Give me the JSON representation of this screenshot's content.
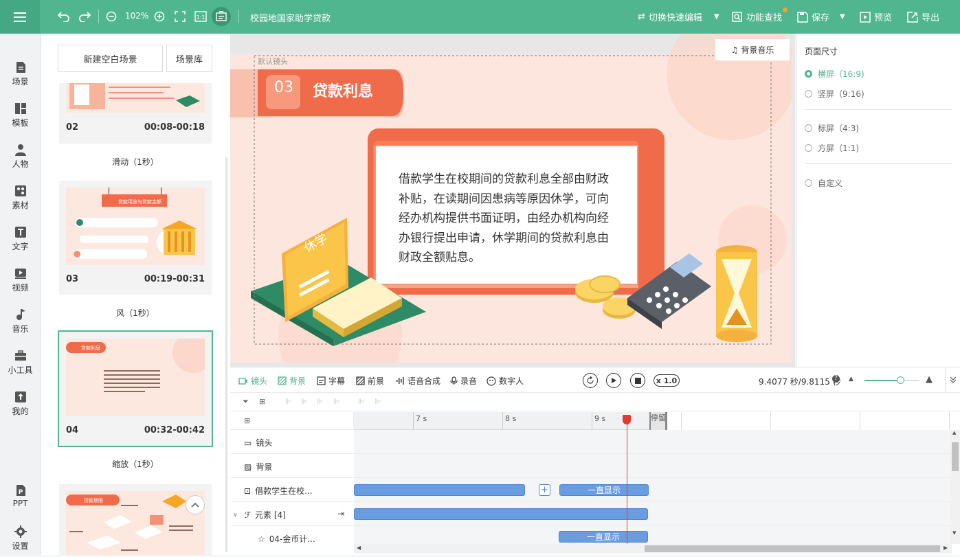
{
  "topbar": {
    "zoom": "102%",
    "title": "校园地国家助学贷款",
    "switch_edit": "切换快速编辑",
    "feature_search": "功能查找",
    "save": "保存",
    "preview": "预览",
    "export": "导出",
    "accent": "#4fb690"
  },
  "leftnav": {
    "items": [
      "场景",
      "模板",
      "人物",
      "素材",
      "文字",
      "视频",
      "音乐",
      "小工具",
      "我的"
    ],
    "bottom": [
      "PPT",
      "设置"
    ]
  },
  "scenes": {
    "new_blank": "新建空白场景",
    "library": "场景库",
    "cards": [
      {
        "num": "02",
        "time": "00:08-00:18"
      },
      {
        "num": "03",
        "time": "00:19-00:31"
      },
      {
        "num": "04",
        "time": "00:32-00:42"
      }
    ],
    "transitions": [
      "滑动（1秒）",
      "风（1秒）",
      "缩放（1秒）"
    ],
    "thumb_titles": [
      "贷款用途与贷款金额",
      "贷款利息",
      "贷款期限"
    ]
  },
  "stage": {
    "camera_label": "默认镜头",
    "bg_music": "背景音乐",
    "heading_num": "03",
    "heading_text": "贷款利息",
    "body": "借款学生在校期间的贷款利息全部由财政补贴，在读期间因患病等原因休学，可向经办机构提供书面证明，由经办机构向经办银行提出申请，休学期间的贷款利息由财政全额贴息。",
    "card_word": "休学"
  },
  "page_size": {
    "title": "页面尺寸",
    "options": [
      "横屏（16:9)",
      "竖屏（9:16)",
      "标屏（4:3)",
      "方屏（1:1)",
      "自定义"
    ],
    "selected": 0
  },
  "timeline": {
    "tabs": [
      "镜头",
      "背景",
      "字幕",
      "前景",
      "语音合成",
      "录音",
      "数字人"
    ],
    "speed": "x 1.0",
    "time": "9.4077 秒/9.8115 秒",
    "ticks": [
      "7 s",
      "8 s",
      "9 s"
    ],
    "end_marker": "停留",
    "rows": [
      "镜头",
      "背景",
      "借款学生在校...",
      "元素 [4]",
      "04-金币计..."
    ],
    "always_show": "一直显示",
    "plus": "+"
  }
}
